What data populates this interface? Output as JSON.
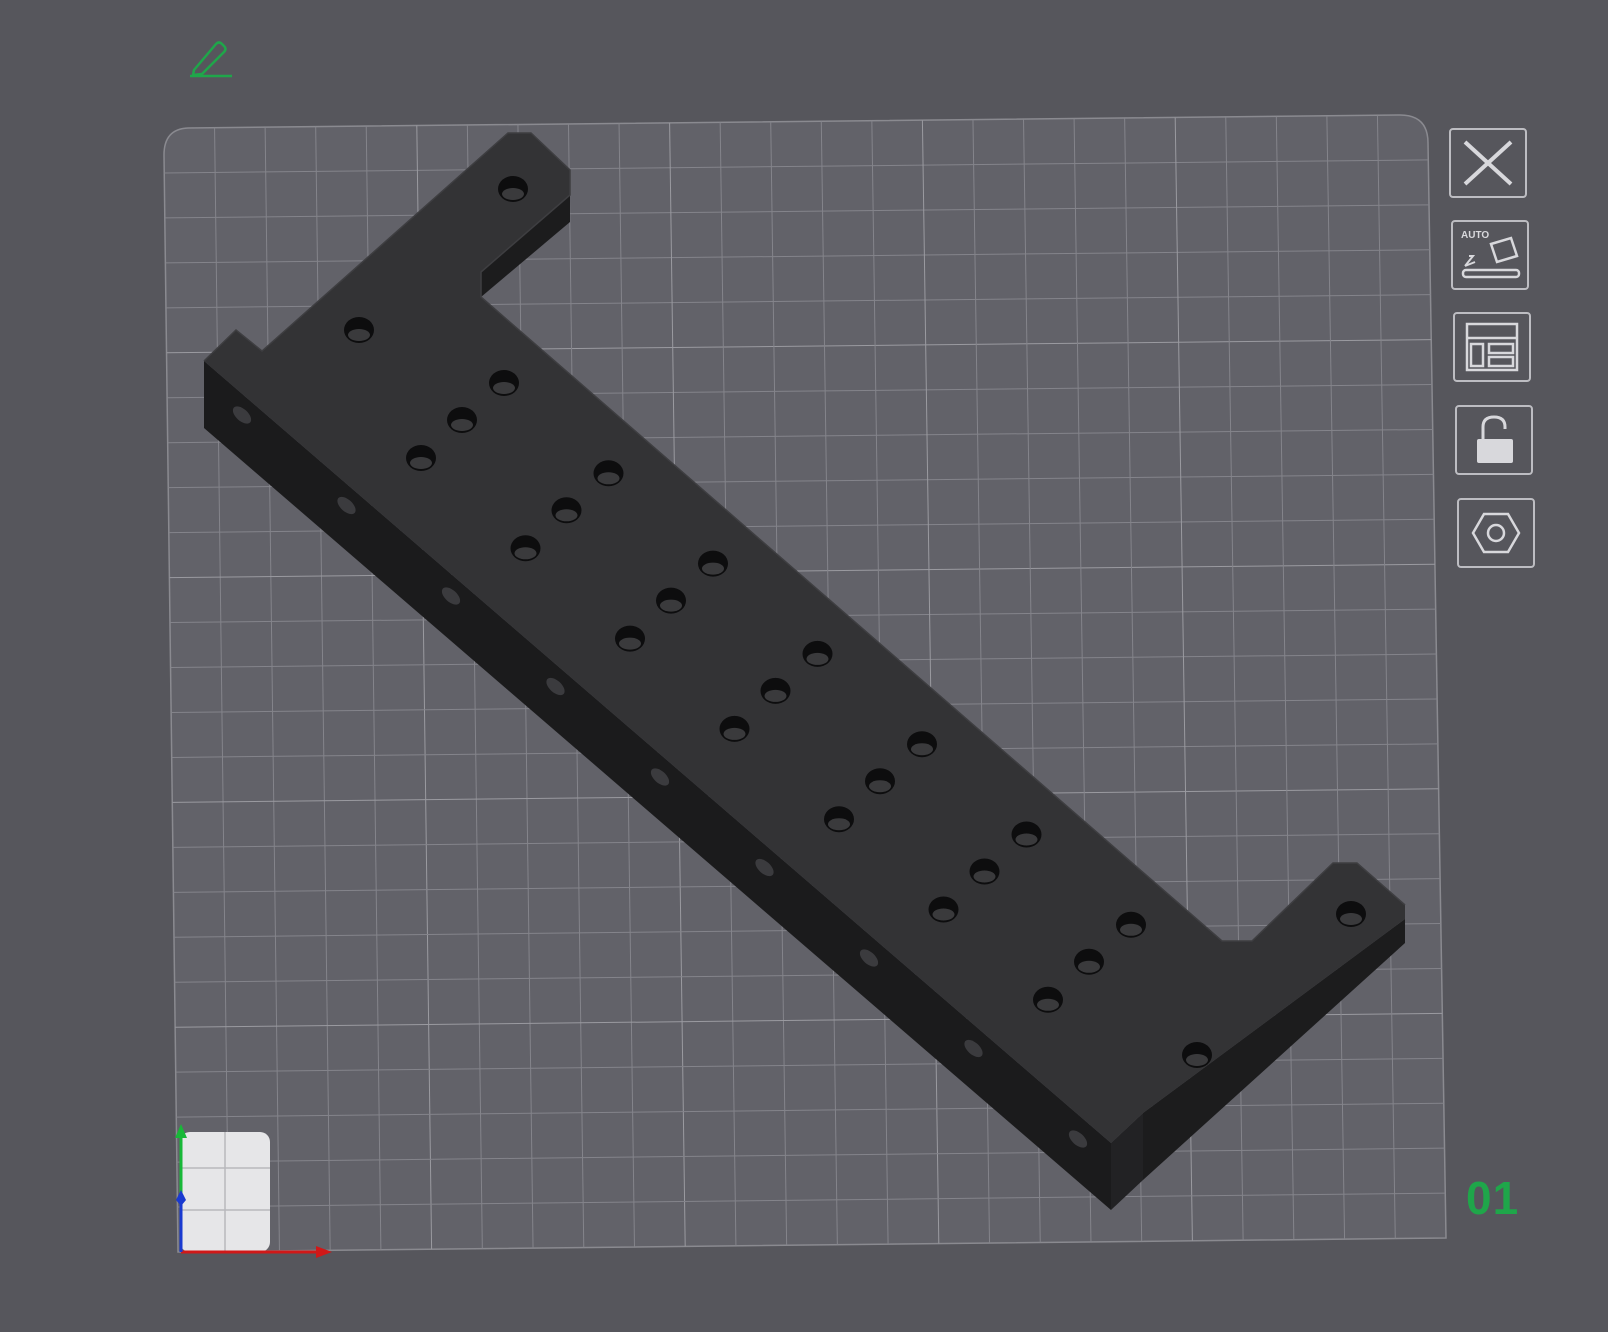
{
  "toolbar": {
    "edit_icon": "pencil-icon",
    "accent_color": "#1fa64a",
    "buttons": [
      {
        "name": "close-button",
        "icon": "close-icon"
      },
      {
        "name": "auto-orient-button",
        "icon": "auto-orient-icon",
        "label": "AUTO"
      },
      {
        "name": "arrange-button",
        "icon": "arrange-icon"
      },
      {
        "name": "lock-button",
        "icon": "unlock-icon"
      },
      {
        "name": "plate-settings-button",
        "icon": "hex-nut-icon"
      }
    ]
  },
  "plate": {
    "number": "01",
    "grid": true,
    "surface_color": "#626269",
    "part_color": "#333335"
  },
  "gizmo": {
    "x_axis_color": "#d01818",
    "y_axis_color": "#18b838",
    "z_axis_color": "#1a3ad0"
  }
}
